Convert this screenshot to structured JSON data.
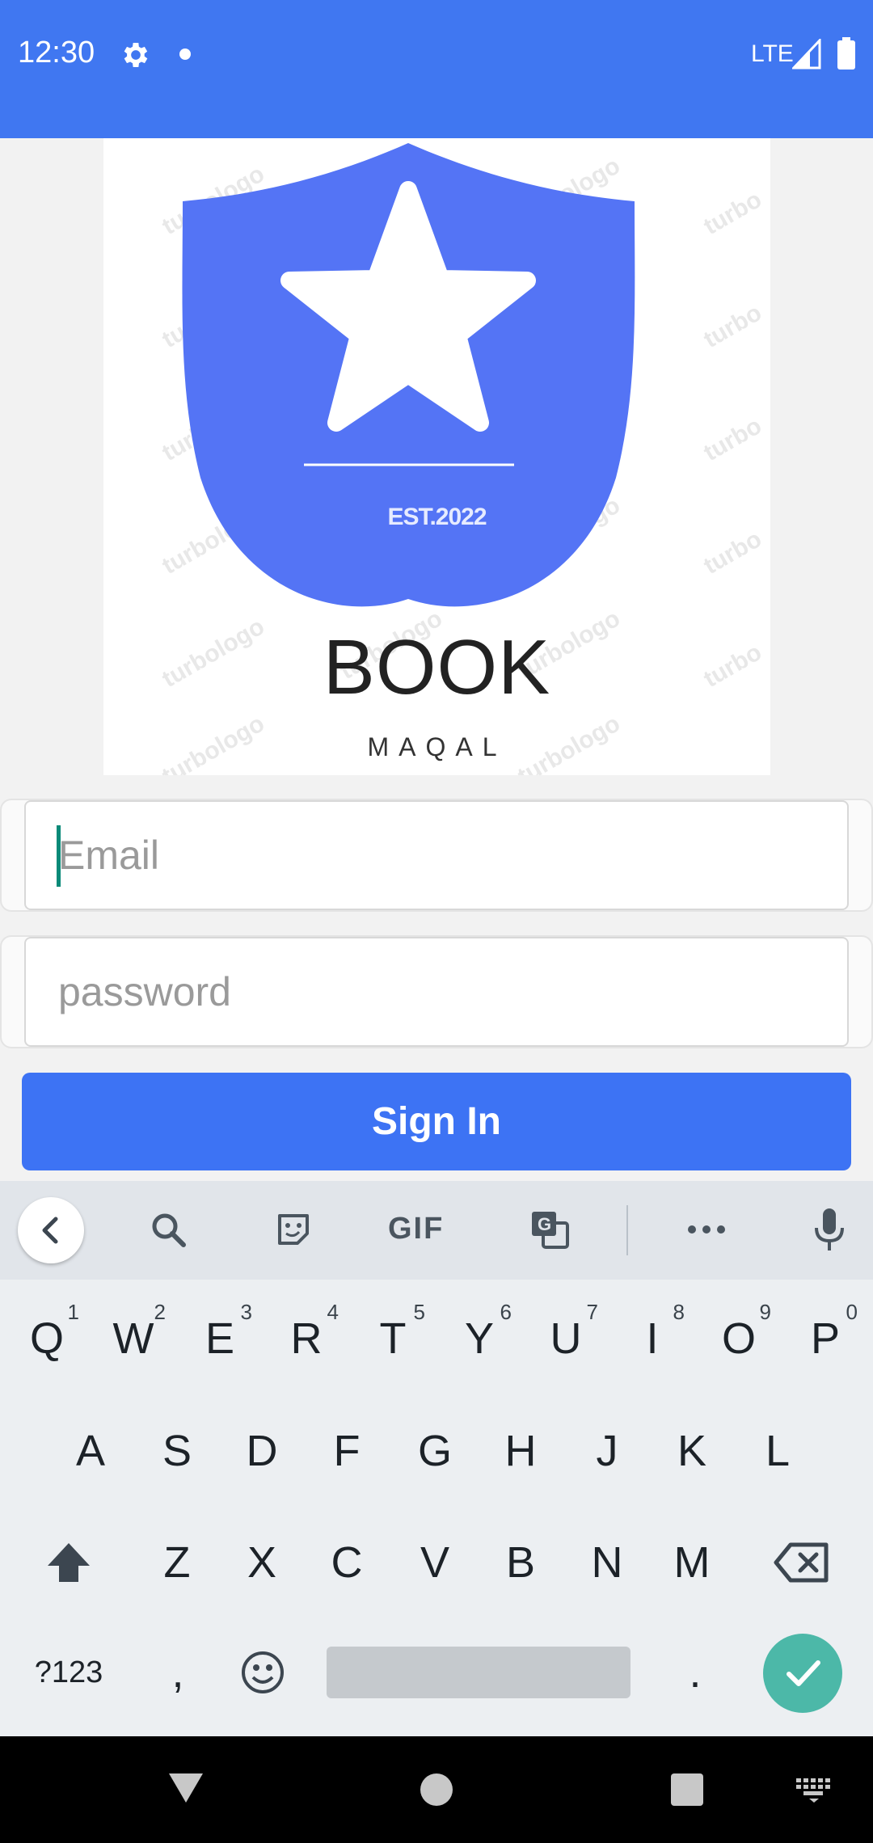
{
  "status_bar": {
    "time": "12:30",
    "network": "LTE",
    "icons": [
      "settings-icon",
      "notification-dot",
      "signal-icon",
      "battery-icon"
    ],
    "background": "#4077f1"
  },
  "logo": {
    "established": "EST.2022",
    "title": "BOOK",
    "subtitle": "MAQAL",
    "watermark": "turbologo",
    "shield_color": "#5474f5"
  },
  "form": {
    "email_placeholder": "Email",
    "password_placeholder": "password",
    "sign_in_label": "Sign In",
    "accent": "#3d73f4"
  },
  "keyboard": {
    "toolbar": [
      "back-icon",
      "search-icon",
      "sticker-icon",
      "GIF",
      "translate-icon",
      "more-icon",
      "mic-icon"
    ],
    "gif_label": "GIF",
    "row1": [
      {
        "key": "Q",
        "hint": "1"
      },
      {
        "key": "W",
        "hint": "2"
      },
      {
        "key": "E",
        "hint": "3"
      },
      {
        "key": "R",
        "hint": "4"
      },
      {
        "key": "T",
        "hint": "5"
      },
      {
        "key": "Y",
        "hint": "6"
      },
      {
        "key": "U",
        "hint": "7"
      },
      {
        "key": "I",
        "hint": "8"
      },
      {
        "key": "O",
        "hint": "9"
      },
      {
        "key": "P",
        "hint": "0"
      }
    ],
    "row2": [
      "A",
      "S",
      "D",
      "F",
      "G",
      "H",
      "J",
      "K",
      "L"
    ],
    "row3": [
      "Z",
      "X",
      "C",
      "V",
      "B",
      "N",
      "M"
    ],
    "symbols_label": "?123",
    "comma": ",",
    "period": ".",
    "enter_color": "#4cb8a8"
  },
  "nav_bar": {
    "buttons": [
      "back-icon",
      "home-icon",
      "recents-icon",
      "keyboard-switch-icon"
    ]
  }
}
